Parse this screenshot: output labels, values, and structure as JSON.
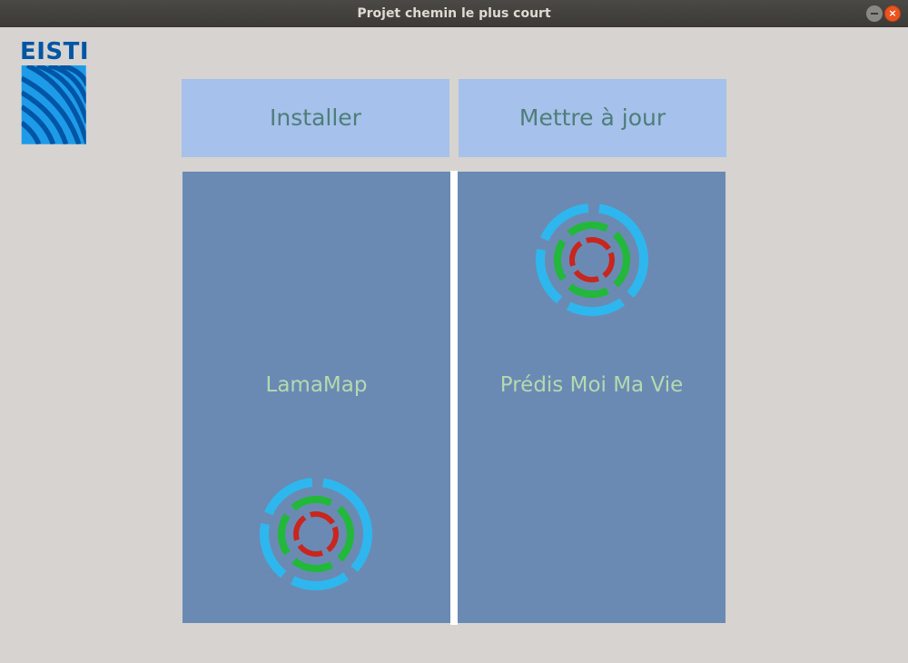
{
  "window": {
    "title": "Projet chemin le plus court",
    "close_glyph": "×"
  },
  "logo": {
    "text": "EISTI",
    "color": "#0055a5",
    "accent": "#1e9be8"
  },
  "buttons": {
    "install_label": "Installer",
    "update_label": "Mettre à jour"
  },
  "apps": [
    {
      "label": "LamaMap",
      "icon": "target-rings-icon"
    },
    {
      "label": "Prédis Moi Ma Vie",
      "icon": "target-rings-icon"
    }
  ],
  "colors": {
    "button_bg": "#a6c1eb",
    "button_text": "#4e7e78",
    "panel_bg": "#6a8ab3",
    "panel_text": "#b5d9b0",
    "ring_outer": "#2eb7ee",
    "ring_middle": "#22b83a",
    "ring_inner": "#c8261e"
  }
}
